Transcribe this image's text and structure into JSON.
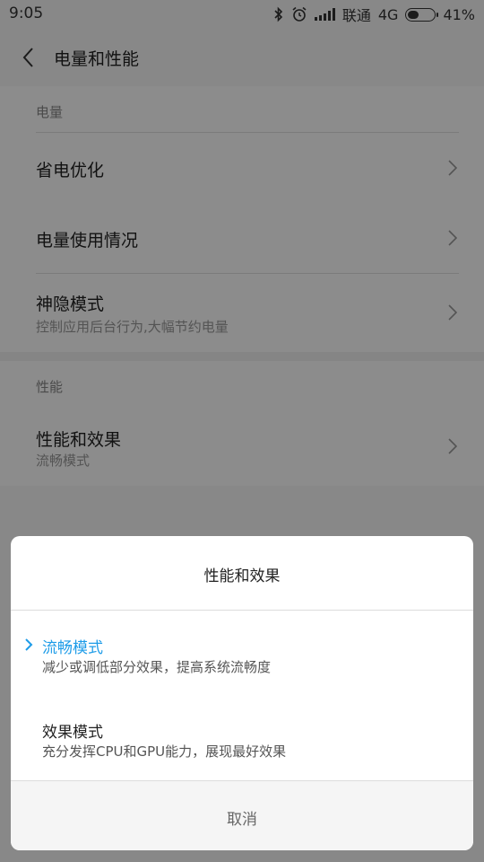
{
  "status_bar": {
    "time": "9:05",
    "carrier": "联通",
    "network": "4G",
    "battery": "41%",
    "battery_level": 0.41
  },
  "header": {
    "title": "电量和性能"
  },
  "battery_section": {
    "title": "电量",
    "items": [
      {
        "label": "省电优化"
      },
      {
        "label": "电量使用情况"
      },
      {
        "label": "神隐模式",
        "subtitle": "控制应用后台行为,大幅节约电量"
      }
    ]
  },
  "performance_section": {
    "title": "性能",
    "items": [
      {
        "label": "性能和效果",
        "subtitle": "流畅模式"
      }
    ]
  },
  "dialog": {
    "title": "性能和效果",
    "options": [
      {
        "label": "流畅模式",
        "description": "减少或调低部分效果，提高系统流畅度",
        "selected": true
      },
      {
        "label": "效果模式",
        "description": "充分发挥CPU和GPU能力，展现最好效果",
        "selected": false
      }
    ],
    "cancel_label": "取消"
  },
  "colors": {
    "accent": "#1e9ce8",
    "background": "#f7f7f7",
    "overlay": "rgba(0,0,0,0.45)"
  }
}
